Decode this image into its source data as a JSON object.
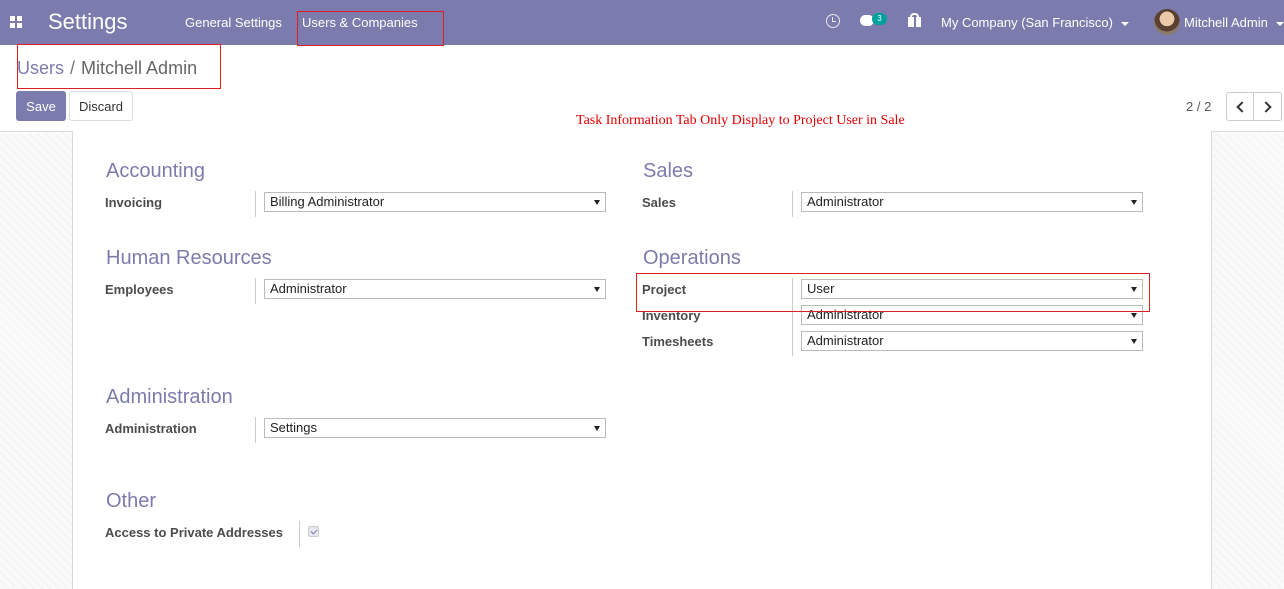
{
  "navbar": {
    "app_title": "Settings",
    "menus": [
      "General Settings",
      "Users & Companies"
    ],
    "chat_badge": "3",
    "company": "My Company (San Francisco)",
    "user": "Mitchell Admin"
  },
  "breadcrumb": {
    "parent": "Users",
    "separator": "/",
    "current": "Mitchell Admin"
  },
  "actions": {
    "save": "Save",
    "discard": "Discard"
  },
  "annotation": "Task Information Tab Only Display to Project User in Sale",
  "pager": {
    "text": "2 / 2"
  },
  "groups": {
    "accounting": {
      "title": "Accounting",
      "fields": [
        {
          "label": "Invoicing",
          "value": "Billing Administrator"
        }
      ]
    },
    "sales": {
      "title": "Sales",
      "fields": [
        {
          "label": "Sales",
          "value": "Administrator"
        }
      ]
    },
    "human_resources": {
      "title": "Human Resources",
      "fields": [
        {
          "label": "Employees",
          "value": "Administrator"
        }
      ]
    },
    "operations": {
      "title": "Operations",
      "fields": [
        {
          "label": "Project",
          "value": "User"
        },
        {
          "label": "Inventory",
          "value": "Administrator"
        },
        {
          "label": "Timesheets",
          "value": "Administrator"
        }
      ]
    },
    "administration": {
      "title": "Administration",
      "fields": [
        {
          "label": "Administration",
          "value": "Settings"
        }
      ]
    },
    "other": {
      "title": "Other",
      "fields": [
        {
          "label": "Access to Private Addresses",
          "checked": true
        }
      ]
    }
  },
  "colors": {
    "brand": "#7c7bad",
    "annotation_red": "#e00000",
    "badge": "#00a09d"
  }
}
